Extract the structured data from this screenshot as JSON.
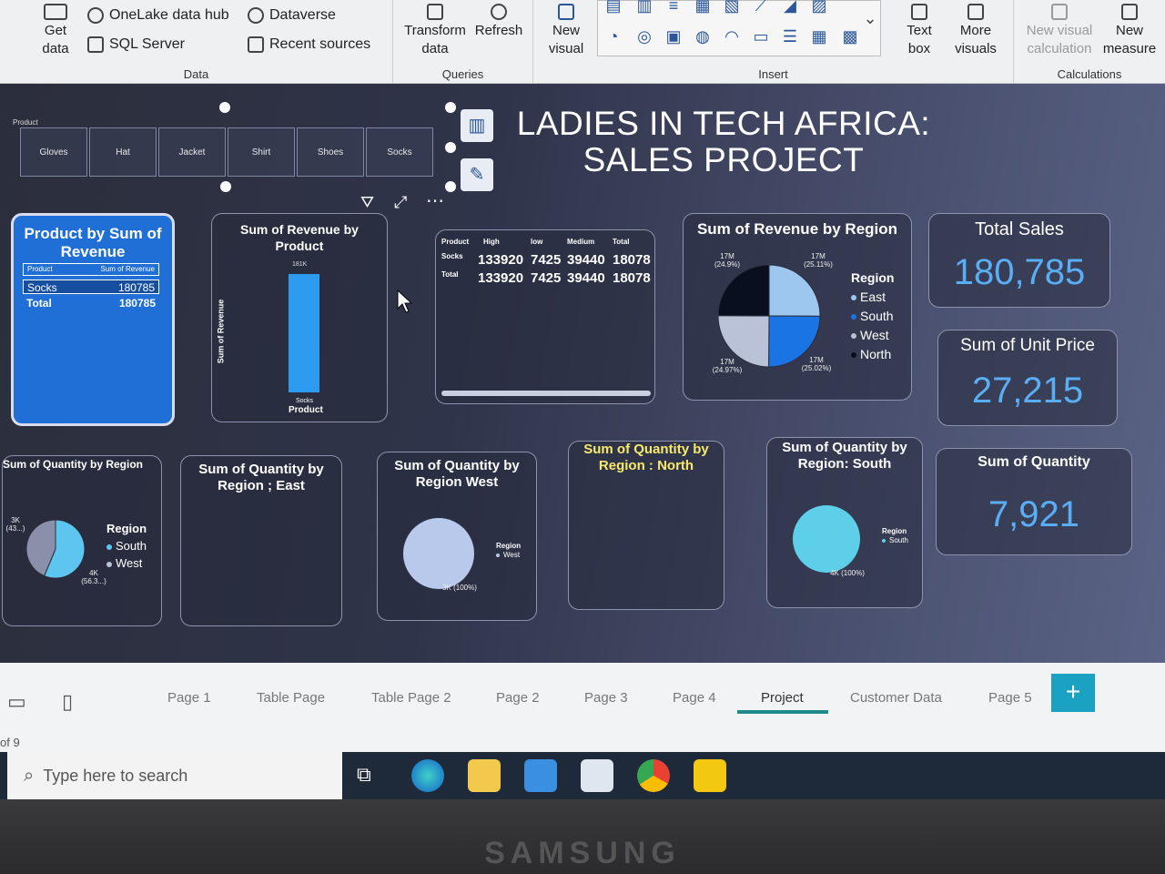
{
  "ribbon": {
    "get_data": "Get data",
    "onelake": "OneLake data hub",
    "dataverse": "Dataverse",
    "sql_server": "SQL Server",
    "recent_sources": "Recent sources",
    "group_data": "Data",
    "transform": "Transform data",
    "refresh": "Refresh",
    "group_queries": "Queries",
    "new_visual": "New visual",
    "group_insert": "Insert",
    "text_box": "Text box",
    "more_visuals": "More visuals",
    "new_visual_calc": "New visual calculation",
    "new_measure": "New measure",
    "group_calculations": "Calculations"
  },
  "slicer": {
    "caption": "Product",
    "items": [
      "Gloves",
      "Hat",
      "Jacket",
      "Shirt",
      "Shoes",
      "Socks"
    ]
  },
  "report_title": {
    "line1": "LADIES IN TECH AFRICA:",
    "line2": "SALES PROJECT"
  },
  "product_table": {
    "title": "Product by Sum of Revenue",
    "col1": "Product",
    "col2": "Sum of Revenue",
    "rows": [
      {
        "product": "Socks",
        "revenue": "180785"
      },
      {
        "product": "Total",
        "revenue": "180785"
      }
    ]
  },
  "revenue_by_product": {
    "title": "Sum of Revenue by Product",
    "ylabel": "Sum of Revenue",
    "xlabel": "Product",
    "bar_label": "181K",
    "category": "Socks"
  },
  "matrix": {
    "headers": [
      "Product",
      "High",
      "low",
      "Medium",
      "Total"
    ],
    "rows": [
      {
        "label": "Socks",
        "values": [
          "133920",
          "7425",
          "39440",
          "18078"
        ]
      },
      {
        "label": "Total",
        "values": [
          "133920",
          "7425",
          "39440",
          "18078"
        ]
      }
    ]
  },
  "revenue_by_region": {
    "title": "Sum of Revenue by Region",
    "legend_title": "Region",
    "legend": [
      "East",
      "South",
      "West",
      "North"
    ],
    "labels": [
      "17M (24.9%)",
      "17M (25.11%)",
      "17M (24.97%)",
      "17M (25.02%)"
    ]
  },
  "kpis": {
    "total_sales_title": "Total Sales",
    "total_sales": "180,785",
    "unit_price_title": "Sum of Unit Price",
    "unit_price": "27,215",
    "quantity_title": "Sum of Quantity",
    "quantity": "7,921"
  },
  "qty_region": {
    "title": "Sum of Quantity by Region",
    "legend_title": "Region",
    "legend": [
      "South",
      "West"
    ],
    "label_top": "3K (43...)",
    "label_bottom": "4K (56.3...)"
  },
  "qty_east": {
    "title": "Sum of Quantity by Region ; East"
  },
  "qty_west": {
    "title": "Sum of Quantity by Region West",
    "legend_title": "Region",
    "legend": "West",
    "label": "3K (100%)"
  },
  "qty_north": {
    "title": "Sum of Quantity by Region : North"
  },
  "qty_south": {
    "title": "Sum of Quantity by Region: South",
    "legend_title": "Region",
    "legend": "South",
    "label": "4K (100%)"
  },
  "tabs": {
    "items": [
      "Page 1",
      "Table Page",
      "Table Page 2",
      "Page 2",
      "Page 3",
      "Page 4",
      "Project",
      "Customer Data",
      "Page 5"
    ],
    "active": "Project",
    "add": "+",
    "page_count": "of 9"
  },
  "taskbar": {
    "search_placeholder": "Type here to search"
  },
  "device": {
    "brand": "SAMSUNG"
  },
  "colors": {
    "accent_blue": "#5aaef5",
    "table_blue": "#1f6fd6",
    "tab_active": "#1e8a8a"
  }
}
